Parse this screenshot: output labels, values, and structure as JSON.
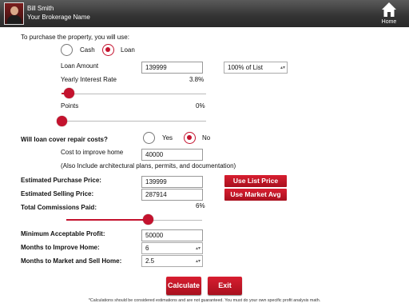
{
  "header": {
    "user_name": "Bill Smith",
    "broker_name": "Your Brokerage Name",
    "home_label": "Home"
  },
  "purchase": {
    "heading": "To purchase the property, you will use:",
    "options": [
      {
        "label": "Cash",
        "selected": false
      },
      {
        "label": "Loan",
        "selected": true
      }
    ]
  },
  "loan": {
    "amount_label": "Loan Amount",
    "amount_value": "139999",
    "percent_select": "100% of List",
    "rate_label": "Yearly Interest Rate",
    "rate_value": "3.8%",
    "rate_slider_level": 0.05,
    "points_label": "Points",
    "points_value": "0%",
    "points_slider_level": 0
  },
  "repair": {
    "question": "Will loan cover repair costs?",
    "options": [
      {
        "label": "Yes",
        "selected": false
      },
      {
        "label": "No",
        "selected": true
      }
    ],
    "cost_label": "Cost to improve home",
    "cost_value": "40000",
    "note": "(Also Include architectural plans, permits, and documentation)"
  },
  "prices": {
    "purchase_label": "Estimated Purchase Price:",
    "purchase_value": "139999",
    "use_list_price": "Use List Price",
    "selling_label": "Estimated Selling Price:",
    "selling_value": "287914",
    "use_market_avg": "Use Market Avg",
    "commissions_label": "Total Commissions Paid:",
    "commissions_value": "6%",
    "commissions_slider_level": 0.6
  },
  "profit": {
    "min_profit_label": "Minimum Acceptable Profit:",
    "min_profit_value": "50000",
    "months_improve_label": "Months to Improve Home:",
    "months_improve_value": "6",
    "months_sell_label": "Months to Market and Sell Home:",
    "months_sell_value": "2.5"
  },
  "actions": {
    "calculate": "Calculate",
    "exit": "Exit"
  },
  "footnote": "*Calculations should be considered estimations and are not guaranteed. You must do your own specific profit analysis math.",
  "colors": {
    "accent": "#c4122e",
    "header_bg": "#3a3a3a"
  }
}
